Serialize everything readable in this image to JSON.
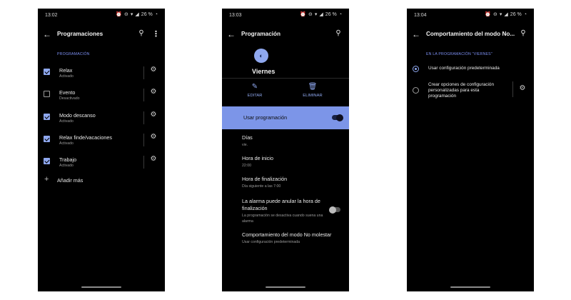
{
  "phone1": {
    "status": {
      "time": "13:02",
      "battery": "26 %"
    },
    "title": "Programaciones",
    "section": "PROGRAMACIÓN",
    "schedules": [
      {
        "name": "Relax",
        "status": "Activado",
        "checked": true
      },
      {
        "name": "Evento",
        "status": "Desactivado",
        "checked": false
      },
      {
        "name": "Modo descanso",
        "status": "Activado",
        "checked": true
      },
      {
        "name": "Relax finde/vacaciones",
        "status": "Activado",
        "checked": true
      },
      {
        "name": "Trabajo",
        "status": "Activado",
        "checked": true
      }
    ],
    "add_more": "Añadir más"
  },
  "phone2": {
    "status": {
      "time": "13:03",
      "battery": "26 %"
    },
    "title": "Programación",
    "schedule_name": "Viernes",
    "edit_label": "EDITAR",
    "delete_label": "ELIMINAR",
    "use_schedule": {
      "label": "Usar programación",
      "enabled": true
    },
    "days": {
      "title": "Días",
      "value": "vie."
    },
    "start": {
      "title": "Hora de inicio",
      "value": "22:00"
    },
    "end": {
      "title": "Hora de finalización",
      "value": "Día siguiente a las 7:00"
    },
    "alarm": {
      "title": "La alarma puede anular la hora de finalización",
      "desc": "La programación se desactiva cuando suena una alarma",
      "enabled": false
    },
    "dnd": {
      "title": "Comportamiento del modo No molestar",
      "value": "Usar configuración predeterminada"
    }
  },
  "phone3": {
    "status": {
      "time": "13:04",
      "battery": "26 %"
    },
    "title": "Comportamiento del modo No...",
    "section": "EN LA PROGRAMACIÓN \"VIERNES\"",
    "option_default": "Usar configuración predeterminada",
    "option_custom": "Crear opciones de configuración personalizadas para esta programación",
    "selected": "default"
  },
  "colors": {
    "accent": "#8fa8ef",
    "highlight": "#7c95e8",
    "background": "#000000"
  }
}
